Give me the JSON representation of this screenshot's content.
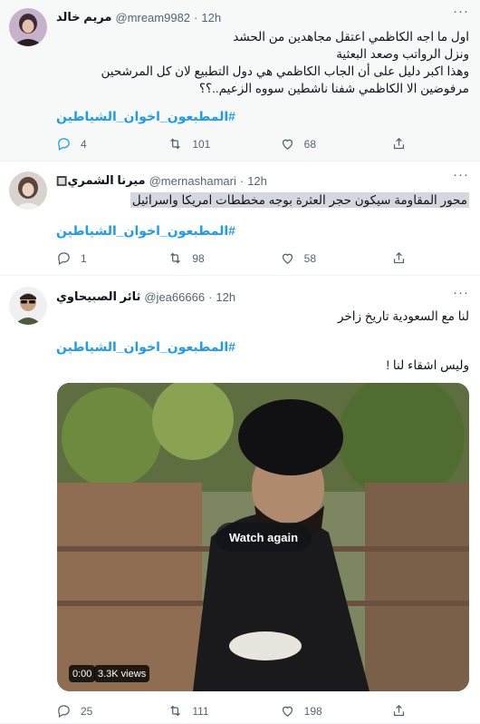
{
  "tweets": [
    {
      "name": "مريم خالد",
      "handle": "@mream9982",
      "dot": "·",
      "time": "12h",
      "lines": [
        "اول ما اجه الكاظمي اعتقل مجاهدين من الحشد",
        "ونزل الرواتب وصعد البعثية",
        "وهذا اكبر دليل على أن الجاب الكاظمي هي دول التطبيع لان كل المرشحين",
        "مرفوضين الا الكاظمي شفنا ناشطين سووه الزعيم..؟؟"
      ],
      "hashtag": "#المطبعون_اخوان_الشياطين",
      "replies": "4",
      "retweets": "101",
      "likes": "68"
    },
    {
      "name": "ميرنا الشمري",
      "name_suffix": "🔲",
      "handle": "@mernashamari",
      "dot": "·",
      "time": "12h",
      "lines": [
        "محور المقاومة سيكون حجر العثرة بوجه مخططات امريكا واسرائيل"
      ],
      "hashtag": "#المطبعون_اخوان_الشياطين",
      "replies": "1",
      "retweets": "98",
      "likes": "58"
    },
    {
      "name": "ثائر الصبيحاوي",
      "handle": "@jea66666",
      "dot": "·",
      "time": "12h",
      "lines": [
        "لنا مع السعودية تاريخ زاخر"
      ],
      "hashtag": "#المطبعون_اخوان_الشياطين",
      "line_after": "وليس اشقاء لنا !",
      "video": {
        "watch_again": "Watch again",
        "duration": "0:00",
        "views": "3.3K views"
      },
      "replies": "25",
      "retweets": "111",
      "likes": "198"
    }
  ],
  "colors": {
    "accent": "#1d9bf0",
    "muted": "#536471",
    "hover_bg": "#f7f9f9"
  },
  "icons": [
    "reply-icon",
    "retweet-icon",
    "like-icon",
    "share-icon",
    "more-icon"
  ]
}
